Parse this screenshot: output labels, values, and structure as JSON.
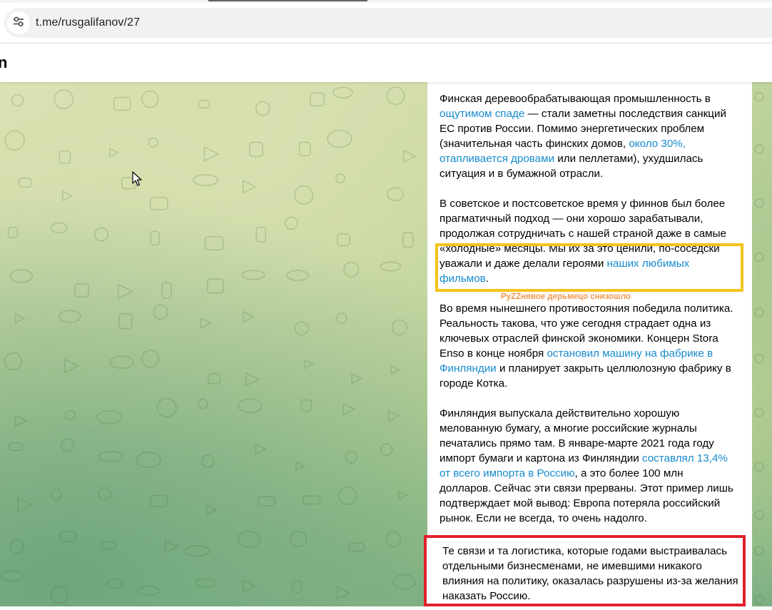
{
  "browser": {
    "url": "t.me/rusgalifanov/27"
  },
  "header": {
    "title_fragment": "n"
  },
  "message": {
    "p1": {
      "t1": "Финская деревообрабатывающая промышленность в ",
      "link1": "ощутимом спаде",
      "t2": " — стали заметны последствия санкций ЕС против России. Помимо энергетических проблем (значительная часть финских домов, ",
      "link2": "около 30%, отапливается дровами",
      "t3": " или пеллетами), ухудшилась ситуация и в бумажной отрасли."
    },
    "p2": {
      "t1": "В советское и постсоветское время у финнов был более прагматичный подход — они хорошо зарабатывали, продолжая сотрудничать с нашей страной даже в самые «холодные» месяцы. Мы их за это ценили, по-соседски уважали и даже делали героями ",
      "link1": "наших любимых фильмов",
      "t2": "."
    },
    "p3": {
      "t1": "Во время нынешнего противостояния победила политика. Реальность такова, что уже сегодня страдает одна из ключевых отраслей финской экономики. Концерн Stora Enso в конце ноября ",
      "link1": "остановил машину на фабрике в Финляндии",
      "t2": " и планирует закрыть целлюлозную фабрику в городе Котка."
    },
    "p4": {
      "t1": "Финляндия выпускала действительно хорошую мелованную бумагу, а многие российские журналы печатались прямо там. В январе-марте 2021 года году импорт бумаги и картона из Финляндии ",
      "link1": "составлял 13,4% от всего импорта в Россию",
      "t2": ", а это более 100 млн долларов. Сейчас эти связи прерваны. Этот пример лишь подтверждает мой вывод: Европа потеряла российский рынок. Если не всегда, то очень надолго."
    }
  },
  "annotations": {
    "caption": "PyZZнявое дерьмецо снизошло",
    "red_box_text": "Те связи и та логистика, которые годами выстраивалась отдельными бизнесменами, не имевшими никакого влияния на политику, оказалась разрушены из-за желания наказать Россию.",
    "colors": {
      "yellow": "#f5c21b",
      "red": "#e2202a",
      "orange": "#f0964a",
      "link": "#168acd"
    }
  },
  "icons": {
    "site_info": "tune-icon",
    "cursor": "mouse-cursor-icon"
  }
}
